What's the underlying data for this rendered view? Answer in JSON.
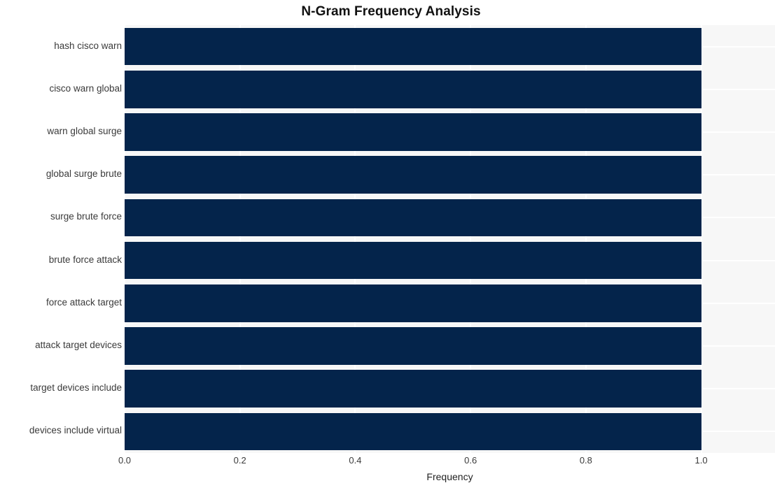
{
  "chart_data": {
    "type": "bar",
    "orientation": "horizontal",
    "title": "N-Gram Frequency Analysis",
    "xlabel": "Frequency",
    "ylabel": "",
    "categories": [
      "hash cisco warn",
      "cisco warn global",
      "warn global surge",
      "global surge brute",
      "surge brute force",
      "brute force attack",
      "force attack target",
      "attack target devices",
      "target devices include",
      "devices include virtual"
    ],
    "values": [
      1.0,
      1.0,
      1.0,
      1.0,
      1.0,
      1.0,
      1.0,
      1.0,
      1.0,
      1.0
    ],
    "xlim": [
      0.0,
      1.128
    ],
    "xticks": [
      0.0,
      0.2,
      0.4,
      0.6,
      0.8,
      1.0
    ],
    "xtick_labels": [
      "0.0",
      "0.2",
      "0.4",
      "0.6",
      "0.8",
      "1.0"
    ],
    "grid": true,
    "legend": null,
    "bar_color": "#04244b",
    "plot_background": "#f7f7f7",
    "gridline_color": "#ffffff",
    "figure_background": "#ffffff"
  }
}
